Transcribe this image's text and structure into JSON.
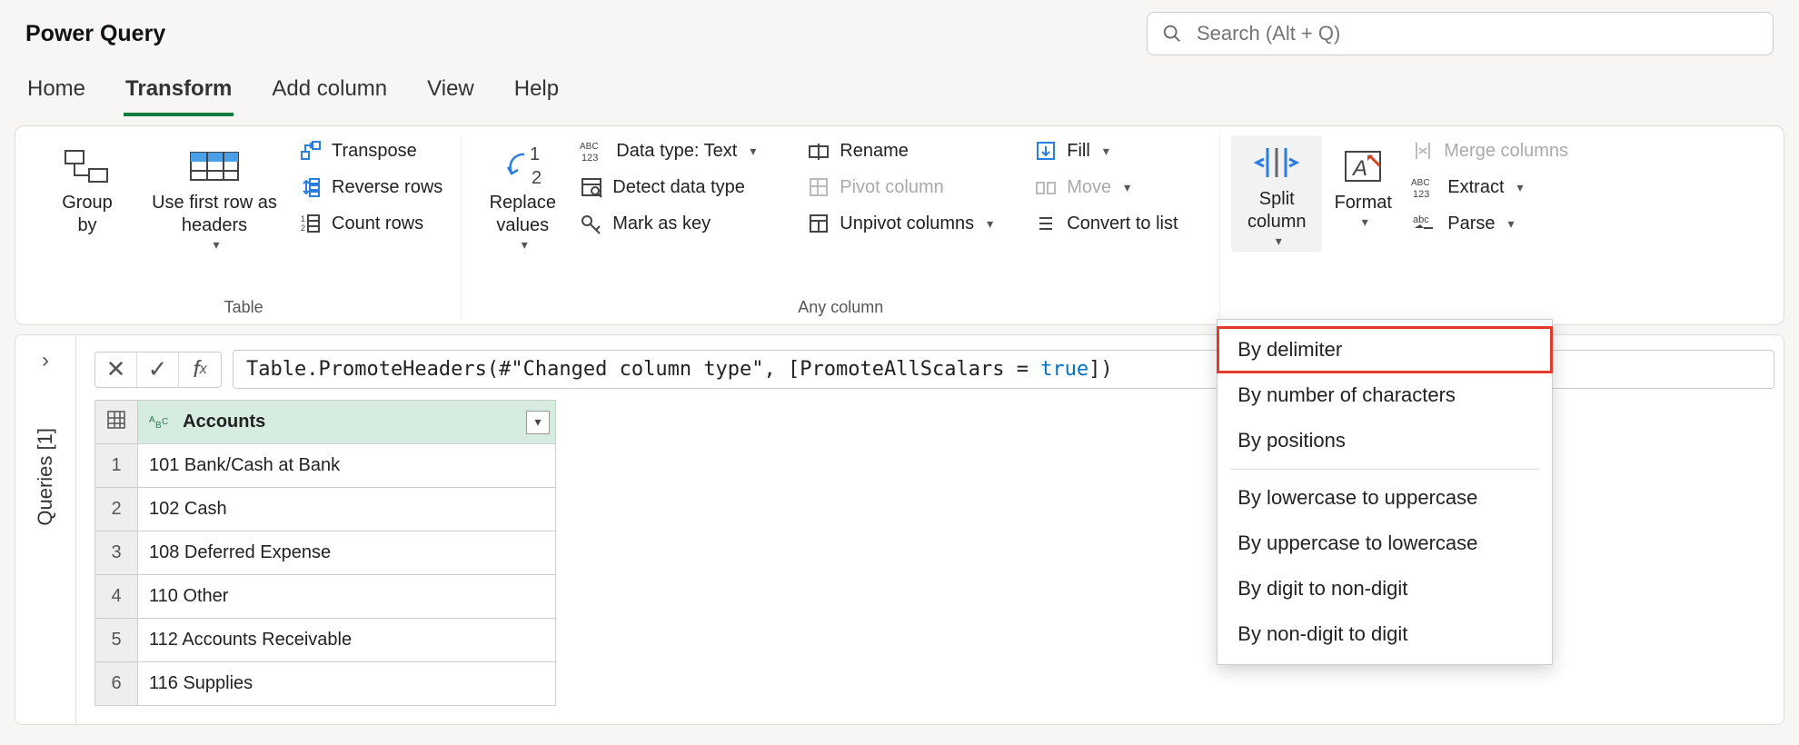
{
  "app_title": "Power Query",
  "search_placeholder": "Search (Alt + Q)",
  "tabs": {
    "home": "Home",
    "transform": "Transform",
    "add_column": "Add column",
    "view": "View",
    "help": "Help"
  },
  "ribbon": {
    "table_group": {
      "label": "Table",
      "group_by": "Group\nby",
      "use_first_row": "Use first row as\nheaders",
      "transpose": "Transpose",
      "reverse_rows": "Reverse rows",
      "count_rows": "Count rows"
    },
    "anycol_group": {
      "label": "Any column",
      "replace_values": "Replace\nvalues",
      "data_type": "Data type: Text",
      "detect_data_type": "Detect data type",
      "mark_as_key": "Mark as key",
      "rename": "Rename",
      "pivot_column": "Pivot column",
      "unpivot_columns": "Unpivot columns",
      "fill": "Fill",
      "move": "Move",
      "convert_to_list": "Convert to list"
    },
    "textcol_group": {
      "split_column": "Split\ncolumn",
      "format": "Format",
      "merge_columns": "Merge columns",
      "extract": "Extract",
      "parse": "Parse"
    },
    "split_menu": {
      "by_delimiter": "By delimiter",
      "by_num_chars": "By number of characters",
      "by_positions": "By positions",
      "by_lower_upper": "By lowercase to uppercase",
      "by_upper_lower": "By uppercase to lowercase",
      "by_digit_nondigit": "By digit to non-digit",
      "by_nondigit_digit": "By non-digit to digit"
    }
  },
  "side": {
    "queries_label": "Queries [1]"
  },
  "formula": {
    "prefix": "Table.PromoteHeaders(#\"Changed column type\", [PromoteAllScalars = ",
    "kw": "true",
    "suffix": "])"
  },
  "grid": {
    "column_header": "Accounts",
    "rows": [
      "101 Bank/Cash at Bank",
      "102 Cash",
      "108 Deferred Expense",
      "110 Other",
      "112 Accounts Receivable",
      "116 Supplies"
    ]
  }
}
